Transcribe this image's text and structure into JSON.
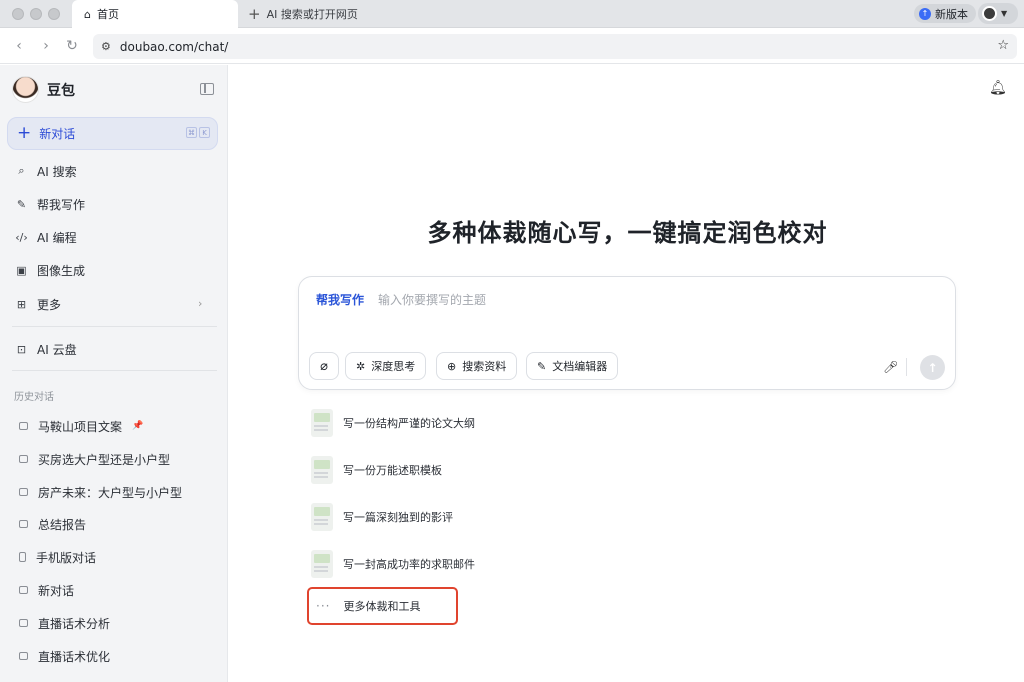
{
  "browser": {
    "active_tab": "首页",
    "new_tab": "AI 搜索或打开网页",
    "new_version": "新版本",
    "url": "doubao.com/chat/"
  },
  "sidebar": {
    "brand": "豆包",
    "new_chat": "新对话",
    "shortcut_keys": [
      "⌘",
      "K"
    ],
    "nav": [
      {
        "label": "AI 搜索",
        "icon": "search-icon"
      },
      {
        "label": "帮我写作",
        "icon": "pen-icon"
      },
      {
        "label": "AI 编程",
        "icon": "code-icon"
      },
      {
        "label": "图像生成",
        "icon": "image-icon"
      },
      {
        "label": "更多",
        "icon": "grid-icon"
      },
      {
        "label": "AI 云盘",
        "icon": "cloud-drive-icon"
      }
    ],
    "history_title": "历史对话",
    "history": [
      "马鞍山项目文案",
      "买房选大户型还是小户型",
      "房产未来：大户型与小户型",
      "总结报告",
      "手机版对话",
      "新对话",
      "直播话术分析",
      "直播话术优化"
    ]
  },
  "main": {
    "headline": "多种体裁随心写，一键搞定润色校对",
    "composer": {
      "skill": "帮我写作",
      "placeholder": "输入你要撰写的主题",
      "chips": [
        "深度思考",
        "搜索资料",
        "文档编辑器"
      ]
    },
    "suggestions": [
      "写一份结构严谨的论文大纲",
      "写一份万能述职模板",
      "写一篇深刻独到的影评",
      "写一封高成功率的求职邮件"
    ],
    "more": "更多体裁和工具"
  },
  "colors": {
    "accent": "#2c56d8",
    "highlight_border": "#e0442e",
    "sidebar_bg": "#f3f4f6"
  }
}
